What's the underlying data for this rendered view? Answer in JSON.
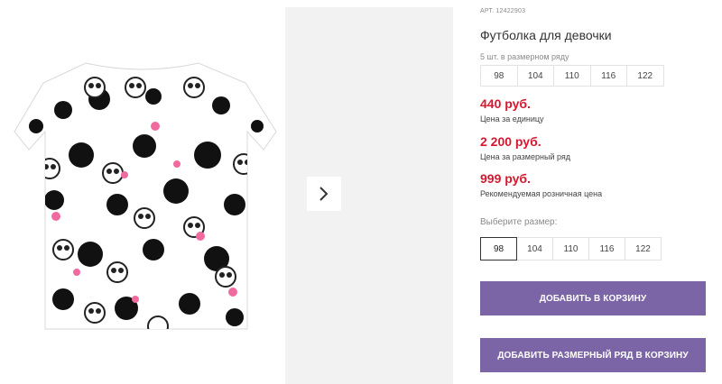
{
  "gallery": {
    "next_icon": "chevron-right-icon"
  },
  "product": {
    "article": "АРТ. 12422903",
    "title": "Футболка для девочки",
    "series_label": "5 шт. в размерном ряду",
    "series_sizes": [
      "98",
      "104",
      "110",
      "116",
      "122"
    ],
    "price_unit": "440 руб.",
    "price_unit_caption": "Цена за единицу",
    "price_series": "2 200 руб.",
    "price_series_caption": "Цена за размерный ряд",
    "price_retail": "999 руб.",
    "price_retail_caption": "Рекомендуемая розничная цена",
    "choose_size_label": "Выберите размер:",
    "size_options": [
      "98",
      "104",
      "110",
      "116",
      "122"
    ],
    "selected_size": "98"
  },
  "actions": {
    "add_to_cart": "ДОБАВИТЬ В КОРЗИНУ",
    "add_series_to_cart": "ДОБАВИТЬ РАЗМЕРНЫЙ РЯД В КОРЗИНУ"
  },
  "colors": {
    "price": "#d6182f",
    "button": "#7b65a6",
    "gallery_bg": "#f2f2f2"
  }
}
